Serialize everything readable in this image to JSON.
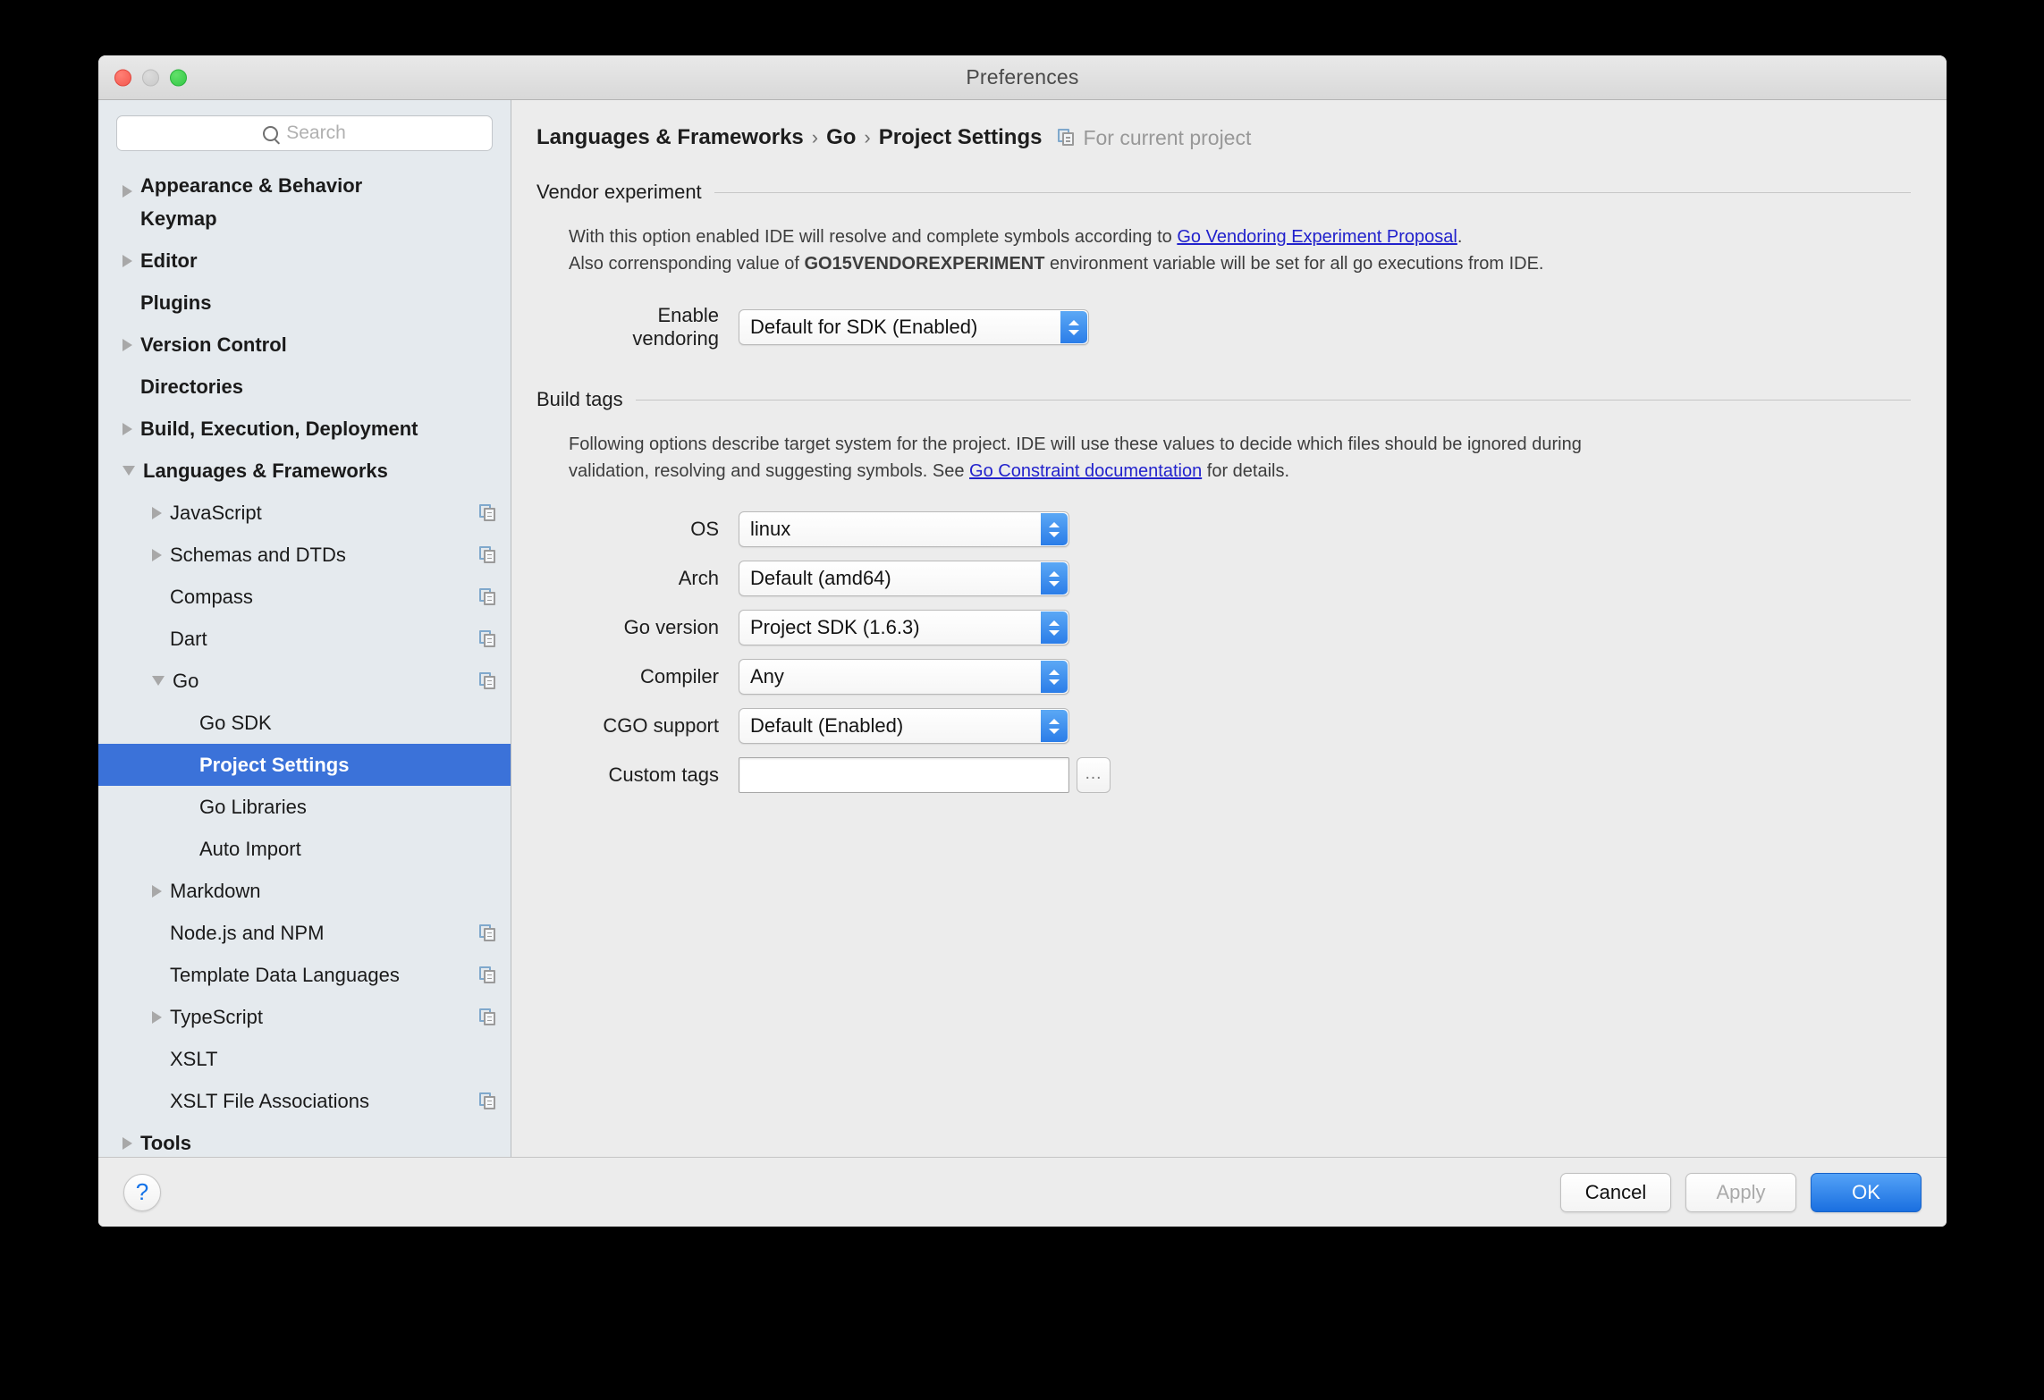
{
  "window": {
    "title": "Preferences",
    "traffic_lights": [
      "close",
      "minimize",
      "zoom"
    ]
  },
  "search": {
    "placeholder": "Search",
    "value": ""
  },
  "sidebar": {
    "items": [
      {
        "label": "Appearance & Behavior",
        "level": 0,
        "twisty": "collapsed",
        "icon": false,
        "selected": false,
        "clipped": true
      },
      {
        "label": "Keymap",
        "level": 0,
        "twisty": "none",
        "icon": false,
        "selected": false
      },
      {
        "label": "Editor",
        "level": 0,
        "twisty": "collapsed",
        "icon": false,
        "selected": false
      },
      {
        "label": "Plugins",
        "level": 0,
        "twisty": "none",
        "icon": false,
        "selected": false
      },
      {
        "label": "Version Control",
        "level": 0,
        "twisty": "collapsed",
        "icon": false,
        "selected": false
      },
      {
        "label": "Directories",
        "level": 0,
        "twisty": "none",
        "icon": false,
        "selected": false
      },
      {
        "label": "Build, Execution, Deployment",
        "level": 0,
        "twisty": "collapsed",
        "icon": false,
        "selected": false
      },
      {
        "label": "Languages & Frameworks",
        "level": 0,
        "twisty": "expanded",
        "icon": false,
        "selected": false
      },
      {
        "label": "JavaScript",
        "level": 1,
        "twisty": "collapsed",
        "icon": true,
        "selected": false
      },
      {
        "label": "Schemas and DTDs",
        "level": 1,
        "twisty": "collapsed",
        "icon": true,
        "selected": false
      },
      {
        "label": "Compass",
        "level": 1,
        "twisty": "none",
        "icon": true,
        "selected": false
      },
      {
        "label": "Dart",
        "level": 1,
        "twisty": "none",
        "icon": true,
        "selected": false
      },
      {
        "label": "Go",
        "level": 1,
        "twisty": "expanded",
        "icon": true,
        "selected": false
      },
      {
        "label": "Go SDK",
        "level": 2,
        "twisty": "none",
        "icon": false,
        "selected": false
      },
      {
        "label": "Project Settings",
        "level": 2,
        "twisty": "none",
        "icon": false,
        "selected": true
      },
      {
        "label": "Go Libraries",
        "level": 2,
        "twisty": "none",
        "icon": false,
        "selected": false
      },
      {
        "label": "Auto Import",
        "level": 2,
        "twisty": "none",
        "icon": false,
        "selected": false
      },
      {
        "label": "Markdown",
        "level": 1,
        "twisty": "collapsed",
        "icon": false,
        "selected": false
      },
      {
        "label": "Node.js and NPM",
        "level": 1,
        "twisty": "none",
        "icon": true,
        "selected": false
      },
      {
        "label": "Template Data Languages",
        "level": 1,
        "twisty": "none",
        "icon": true,
        "selected": false
      },
      {
        "label": "TypeScript",
        "level": 1,
        "twisty": "collapsed",
        "icon": true,
        "selected": false
      },
      {
        "label": "XSLT",
        "level": 1,
        "twisty": "none",
        "icon": false,
        "selected": false
      },
      {
        "label": "XSLT File Associations",
        "level": 1,
        "twisty": "none",
        "icon": true,
        "selected": false
      },
      {
        "label": "Tools",
        "level": 0,
        "twisty": "collapsed",
        "icon": false,
        "selected": false
      }
    ]
  },
  "breadcrumb": {
    "segments": [
      "Languages & Frameworks",
      "Go",
      "Project Settings"
    ],
    "separator": "›",
    "scope_label": "For current project",
    "scope_icon": "project-scope-icon"
  },
  "vendor_section": {
    "title": "Vendor experiment",
    "desc_line1_before": "With this option enabled IDE will resolve and complete symbols according to ",
    "desc_line1_link": "Go Vendoring Experiment Proposal",
    "desc_line1_after": ".",
    "desc_line2_before": "Also corrensponding value of ",
    "desc_line2_bold": "GO15VENDOREXPERIMENT",
    "desc_line2_after": " environment variable will be set for all go executions from IDE.",
    "enable_vendoring_label": "Enable vendoring",
    "enable_vendoring_value": "Default for SDK (Enabled)"
  },
  "build_tags_section": {
    "title": "Build tags",
    "desc_line1": "Following options describe target system for the project. IDE will use these values to decide which files should be ignored during",
    "desc_line2_before": "validation, resolving and suggesting symbols. See ",
    "desc_line2_link": "Go Constraint documentation",
    "desc_line2_after": " for details.",
    "fields": [
      {
        "label": "OS",
        "value": "linux",
        "type": "combo"
      },
      {
        "label": "Arch",
        "value": "Default (amd64)",
        "type": "combo"
      },
      {
        "label": "Go version",
        "value": "Project SDK (1.6.3)",
        "type": "combo"
      },
      {
        "label": "Compiler",
        "value": "Any",
        "type": "combo"
      },
      {
        "label": "CGO support",
        "value": "Default (Enabled)",
        "type": "combo"
      },
      {
        "label": "Custom tags",
        "value": "",
        "type": "text",
        "browse_label": "..."
      }
    ]
  },
  "footer": {
    "help_glyph": "?",
    "cancel_label": "Cancel",
    "apply_label": "Apply",
    "apply_enabled": false,
    "ok_label": "OK"
  },
  "colors": {
    "accent_selection": "#3b72d9",
    "primary_button": "#1a6fe0",
    "link": "#2222cc",
    "sidebar_bg": "#e5eaee",
    "content_bg": "#ececec"
  }
}
